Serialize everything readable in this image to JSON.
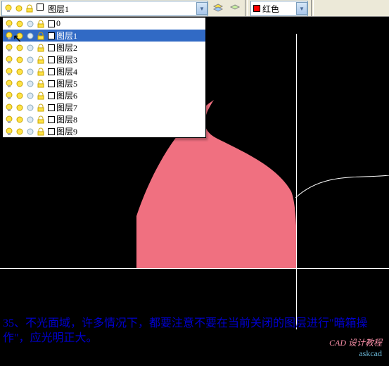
{
  "toolbar": {
    "current_layer": "图层1",
    "color_label": "红色",
    "color_hex": "#ff0000"
  },
  "layer_list": [
    {
      "name": "0"
    },
    {
      "name": "图层1",
      "selected": true
    },
    {
      "name": "图层2"
    },
    {
      "name": "图层3"
    },
    {
      "name": "图层4"
    },
    {
      "name": "图层5"
    },
    {
      "name": "图层6"
    },
    {
      "name": "图层7"
    },
    {
      "name": "图层8"
    },
    {
      "name": "图层9"
    }
  ],
  "icons": {
    "bulb": "lightbulb-icon",
    "sun": "sun-icon",
    "lock": "lock-icon",
    "swatch": "color-swatch"
  },
  "caption": "35、不光面域，许多情况下，都要注意不要在当前关闭的图层进行\"暗箱操作\"，应光明正大。",
  "watermarks": {
    "w1": "CAD 设计教程",
    "w2": "askcad"
  },
  "canvas": {
    "shape_color": "#f07080",
    "bg": "#000000",
    "crosshair": "#ffffff"
  }
}
